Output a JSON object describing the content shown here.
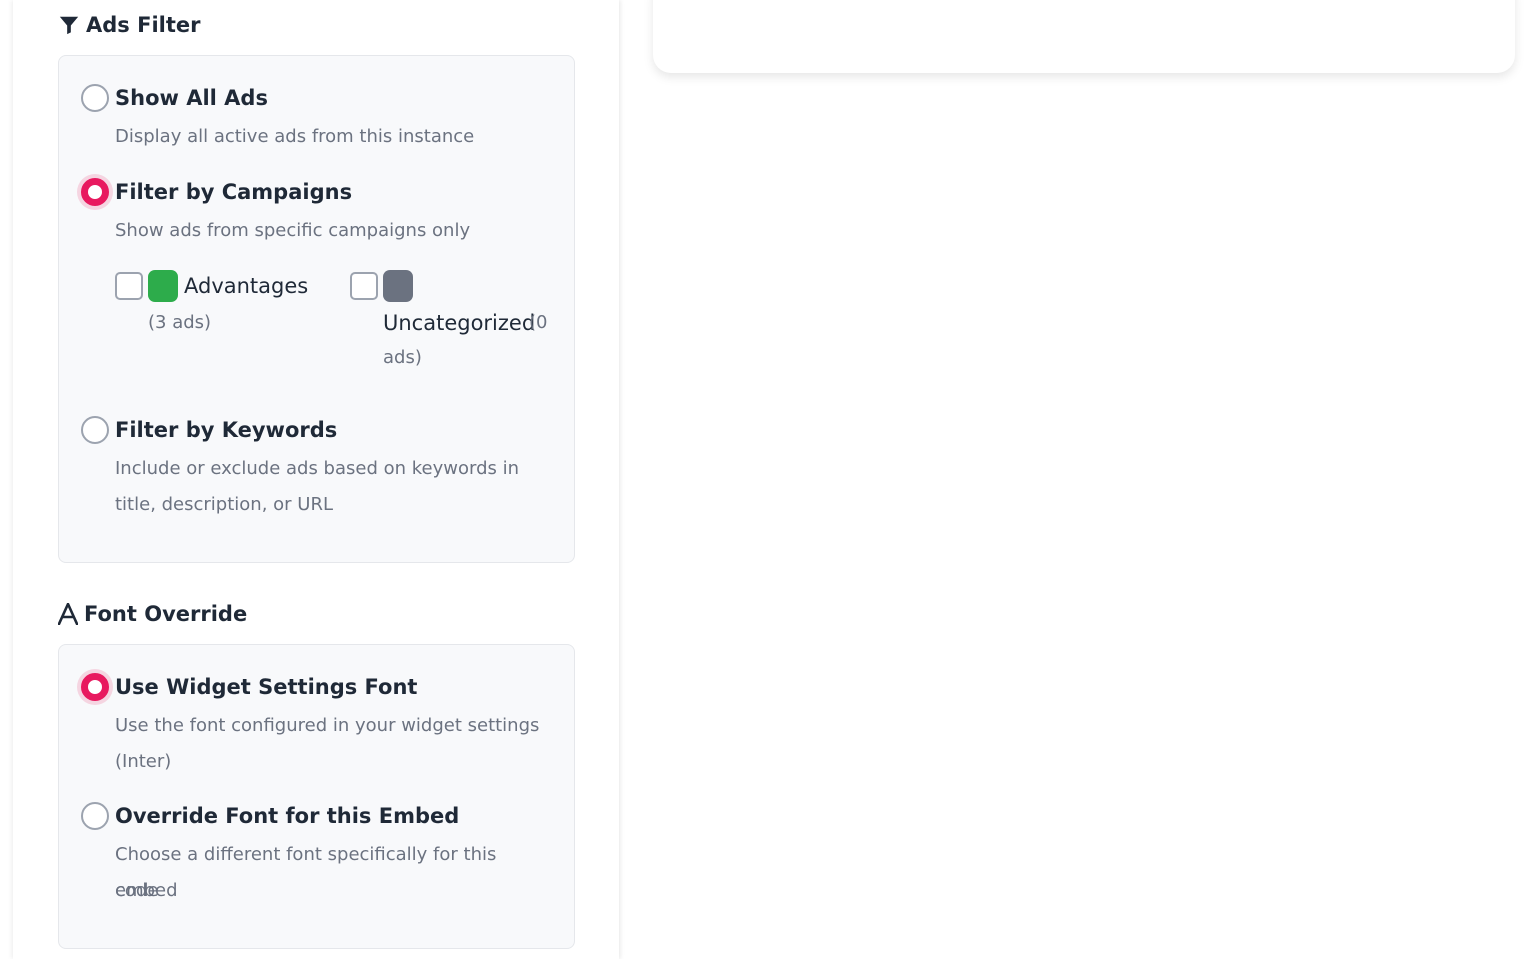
{
  "ads_filter": {
    "title": "Ads Filter",
    "icon": "funnel-icon",
    "options": [
      {
        "label": "Show All Ads",
        "description": "Display all active ads from this instance",
        "selected": false
      },
      {
        "label": "Filter by Campaigns",
        "description": "Show ads from specific campaigns only",
        "selected": true
      },
      {
        "label": "Filter by Keywords",
        "description": "Include or exclude ads based on keywords in title, description, or URL",
        "selected": false
      }
    ],
    "campaigns": [
      {
        "name": "Advantages",
        "count": "(3 ads)",
        "color": "#2dac4b",
        "checked": false
      },
      {
        "name": "Uncategorized",
        "count_a": "(0",
        "count_b": "ads)",
        "color": "#6b7280",
        "checked": false
      }
    ]
  },
  "font_override": {
    "title": "Font Override",
    "icon": "font-a-icon",
    "options": [
      {
        "label": "Use Widget Settings Font",
        "description_a": "Use the font configured in your widget settings",
        "description_b": "(Inter)",
        "selected": true
      },
      {
        "label": "Override Font for this Embed",
        "description_a": "Choose a different font specifically for this embed",
        "description_b": "code",
        "selected": false
      }
    ]
  },
  "colors": {
    "accent": "#e8195f",
    "card_background": "#f8f9fb",
    "muted_text": "#6b7280"
  }
}
